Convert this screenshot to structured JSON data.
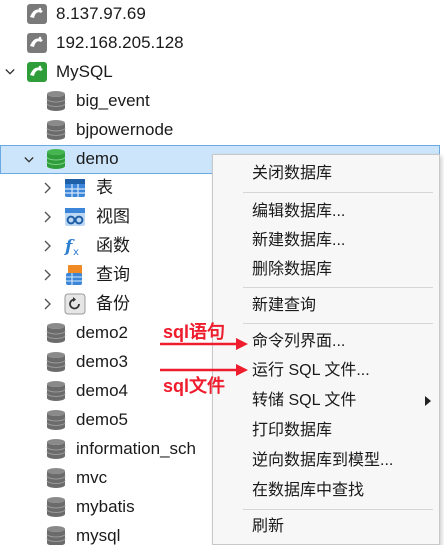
{
  "tree": {
    "conn1": "8.137.97.69",
    "conn2": "192.168.205.128",
    "conn3": "MySQL",
    "databases": {
      "big_event": "big_event",
      "bjpowernode": "bjpowernode",
      "demo": "demo",
      "demo2": "demo2",
      "demo3": "demo3",
      "demo4": "demo4",
      "demo5": "demo5",
      "information_schema": "information_sch",
      "mvc": "mvc",
      "mybatis": "mybatis",
      "mysql": "mysql"
    },
    "demo_children": {
      "tables": "表",
      "views": "视图",
      "functions": "函数",
      "queries": "查询",
      "backups": "备份"
    }
  },
  "context_menu": {
    "items": [
      "关闭数据库",
      "编辑数据库...",
      "新建数据库...",
      "删除数据库",
      "新建查询",
      "命令列界面...",
      "运行 SQL 文件...",
      "转储 SQL 文件",
      "打印数据库",
      "逆向数据库到模型...",
      "在数据库中查找",
      "刷新"
    ]
  },
  "annotations": {
    "sql_statement": "sql语句",
    "sql_file": "sql文件"
  },
  "colors": {
    "selection": "#cce5fb",
    "annotation": "#ee1c2c",
    "db_icon_gray": "#6b6b6b",
    "db_icon_green": "#2e9d3a"
  }
}
